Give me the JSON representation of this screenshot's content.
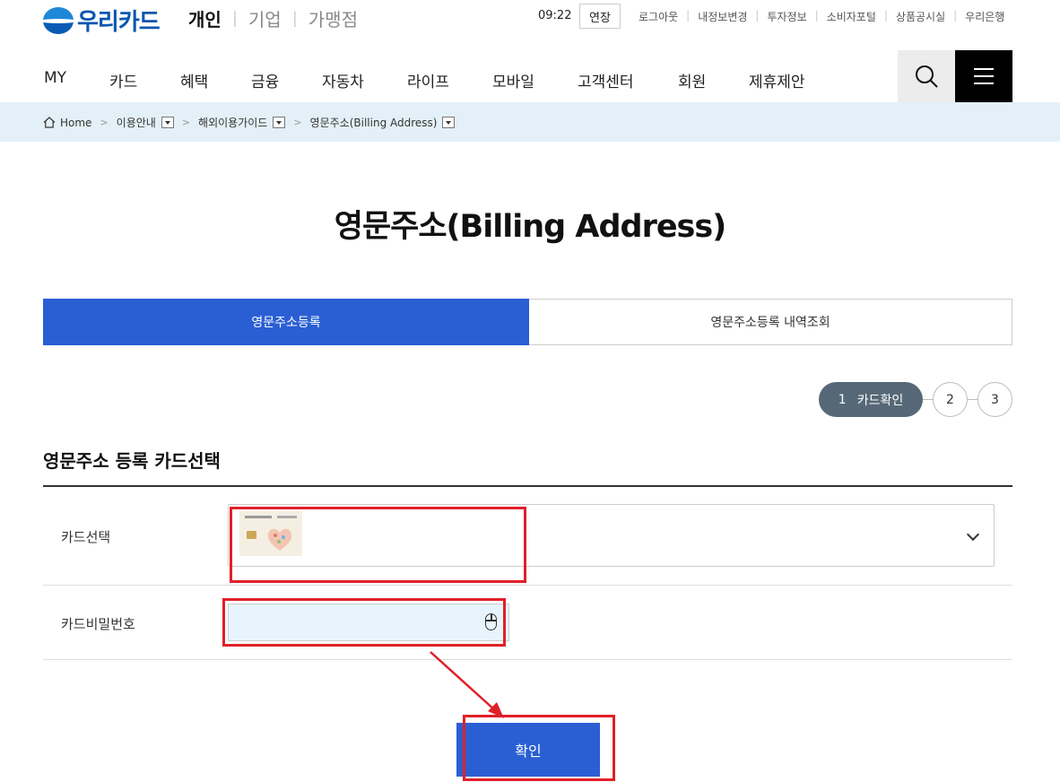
{
  "header": {
    "logo_text": "우리카드",
    "segments": [
      "개인",
      "기업",
      "가맹점"
    ],
    "session_timer": "09:22",
    "extend_label": "연장",
    "utility_links": [
      "로그아웃",
      "내정보변경",
      "투자정보",
      "소비자포털",
      "상품공시실",
      "우리은행"
    ]
  },
  "nav": {
    "items": [
      "MY",
      "카드",
      "혜택",
      "금융",
      "자동차",
      "라이프",
      "모바일",
      "고객센터",
      "회원",
      "제휴제안"
    ]
  },
  "breadcrumb": {
    "home": "Home",
    "items": [
      "이용안내",
      "해외이용가이드",
      "영문주소(Billing Address)"
    ]
  },
  "page": {
    "title": "영문주소(Billing Address)"
  },
  "tabs": [
    {
      "label": "영문주소등록",
      "active": true
    },
    {
      "label": "영문주소등록 내역조회",
      "active": false
    }
  ],
  "steps": {
    "current_number": "1",
    "current_label": "카드확인",
    "others": [
      "2",
      "3"
    ]
  },
  "form": {
    "section_title": "영문주소 등록 카드선택",
    "card_select_label": "카드선택",
    "password_label": "카드비밀번호",
    "password_value": "",
    "confirm_label": "확인"
  },
  "colors": {
    "primary": "#2a5fd4",
    "step_active": "#566877",
    "breadcrumb_bg": "#e3f0f7",
    "annotation": "#e0202a"
  }
}
